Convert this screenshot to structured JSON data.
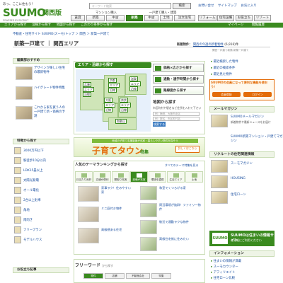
{
  "header": {
    "tagline": "あっ、ここに住もう！",
    "logo_text": "SUUMO",
    "logo_region": "関西版",
    "logo_sub": "POWERED BY RECRUIT",
    "search_placeholder": "キーワード検索",
    "search_button": "検索",
    "top_links": [
      "お問い合せ",
      "サイトマップ",
      "お気に入り"
    ],
    "nav_top_labels": [
      "マンション購入",
      "一戸建て購入・建築"
    ],
    "nav": [
      "賃貸",
      "新築",
      "中古",
      "新築",
      "中古",
      "土地",
      "注文住宅",
      "リフォーム",
      "住宅設備",
      "お役立ち",
      "リゾート"
    ],
    "greenbar_left": "エリアから探す",
    "greenbar_mid": "沿線から探す",
    "greenbar_mid2": "地図から探す",
    "greenbar_mid3": "こだわり条件から探す",
    "greenbar_right": "マイページ",
    "greenbar_right2": "閲覧履歴"
  },
  "breadcrumb": "不動産・住宅サイト SUUMO(スーモ)トップ ＞ 関西 ＞ 新築一戸建て",
  "page_title": "新築一戸建て ｜ 関西エリア",
  "updated": {
    "label": "新着物件：",
    "link": "関西の今週の新着物件",
    "count": "(6,916)件"
  },
  "note": "関西一戸建て新築 新築一戸建て",
  "left": {
    "recommend_title": "編集部おすすめ",
    "recommend": [
      "デザインが楽しい住宅の最新物件",
      "ハイグレード物件特集",
      "これから家を買う人の一戸建て新・価格の予測"
    ],
    "feature_title": "特徴から探す",
    "features": [
      "3000万円以下",
      "駅徒歩10分以内",
      "LDK15畳以上",
      "太陽光発電",
      "オール電化",
      "2台以上駐車",
      "角地",
      "南向き",
      "フリープラン",
      "モデルハウス"
    ],
    "help_title": "お役立ち記事"
  },
  "area": {
    "header": "エリア・沿線から探す",
    "prefs": [
      "兵庫",
      "エリア",
      "沿線",
      "京都",
      "エリア",
      "沿線",
      "滋賀",
      "エリア",
      "沿線",
      "大阪",
      "エリア",
      "沿線",
      "奈良",
      "エリア",
      "沿線",
      "和歌山"
    ],
    "options": [
      "価格×広さから探す",
      "通勤・通学時間から探す",
      "路線図から探す"
    ],
    "map_title": "地図から探す",
    "map_desc": "市区町村や駅名など住所を入れて下さい",
    "map_input1": "例：梅田、大阪市北区",
    "map_input2": "例：駅名、市区町村名",
    "map_button": "検索する"
  },
  "banner": {
    "top": "地域の子育て支援制度が充実・暮らしやすい物件を探そう",
    "main": "子育てタウン",
    "suffix": "特集",
    "button": "詳しくはこちら"
  },
  "theme": {
    "title": "人気のテーマランキングから探す",
    "link": "すべてのテーマ特集を見る",
    "tabs": [
      "日当たり良好",
      "交通が便利",
      "間取り充実",
      "設備が充実",
      "環境を重視",
      "注目エリア",
      "土地"
    ],
    "left_items": [
      "家事ラク！住みやすい家",
      "ミニ庭付き物件",
      "高級感ある住宅"
    ],
    "right_items": [
      "和室でくつろげる家",
      "周辺環境が抜群！ファミリー物件",
      "駅近で通勤ラクな物件",
      "高級住宅街に住みたい"
    ]
  },
  "freeword": {
    "title": "フリーワード",
    "sub": "から探す",
    "tabs": [
      "物件",
      "店舗",
      "不動産会社",
      "特集"
    ]
  },
  "right": {
    "links_top": [
      "最近検索した物件",
      "最近の検索条件",
      "最近見た物件"
    ],
    "orange_text": "SUUMOの会員になって便利な機能を使おう！",
    "orange_btn1": "会員登録",
    "orange_btn2": "ログイン",
    "mail_title": "メールマガジン",
    "mail_items": [
      "SUUMOメールマガジン",
      "新着物件や最新ニュースをお届け",
      "SUUMO新築マンション・戸建てマガジン"
    ],
    "recruit_title": "リクルートの住宅関連情報",
    "recruit_items": [
      "スーモマガジン",
      "HOUSING",
      "住宅ローン"
    ],
    "suumoq_title": "SUUMOは住まいの情報サイト",
    "suumoq_sub": "お気軽にご利用ください",
    "suumoq_badge": "SUUMO",
    "info_title": "インフォメーション",
    "info_items": [
      "住まいの情報が満載",
      "スーモカウンター",
      "アフィリエイト",
      "住宅ローン比較"
    ]
  }
}
